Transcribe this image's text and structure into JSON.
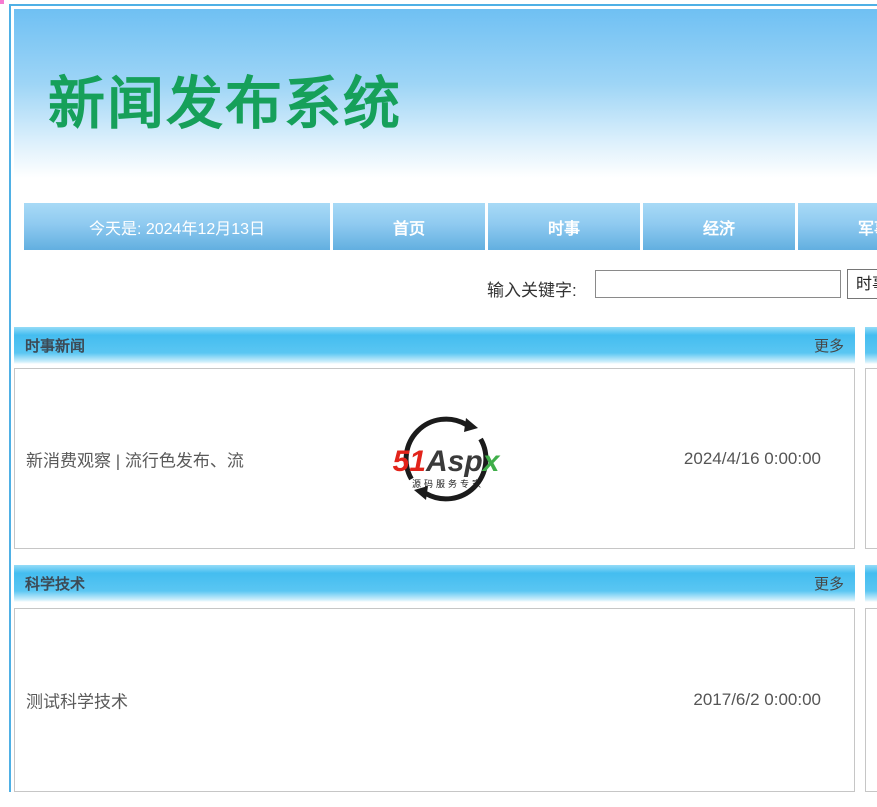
{
  "page": {
    "site_title": "新闻发布系统"
  },
  "navbar": {
    "date_label": "今天是: 2024年12月13日",
    "items": [
      {
        "label": "首页"
      },
      {
        "label": "时事"
      },
      {
        "label": "经济"
      },
      {
        "label": "军事"
      }
    ]
  },
  "search": {
    "label": "输入关键字:",
    "input_value": "",
    "category_selected": "时事"
  },
  "sections": [
    {
      "title": "时事新闻",
      "more_label": "更多",
      "items": [
        {
          "title": "新消费观察 | 流行色发布、流",
          "date": "2024/4/16 0:00:00"
        }
      ]
    },
    {
      "title": "科学技术",
      "more_label": "更多",
      "items": [
        {
          "title": "测试科学技术",
          "date": "2017/6/2 0:00:00"
        }
      ]
    }
  ],
  "logo": {
    "part_51": "51",
    "part_asp": "Asp",
    "part_x": "x",
    "tagline": "源码服务专家"
  },
  "colors": {
    "title_green": "#16a05a",
    "nav_blue_top": "#a8daf6",
    "nav_blue_bottom": "#62afe0",
    "section_bar_blue": "#4fc0f0",
    "page_border_blue": "#4fb0e5",
    "logo_red": "#e2231a",
    "logo_green": "#3fae49"
  }
}
